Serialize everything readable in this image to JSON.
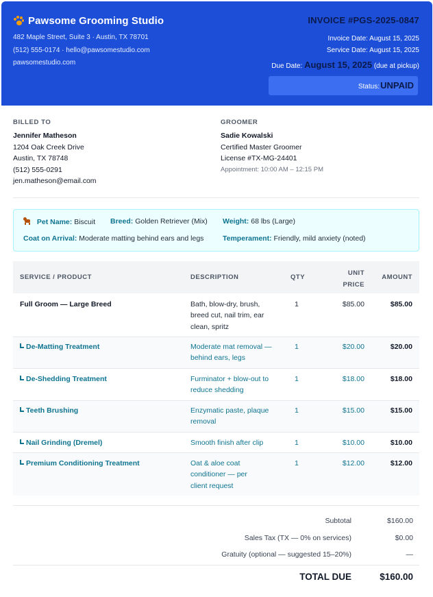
{
  "header": {
    "studio_name": "Pawsome Grooming Studio",
    "address": "482 Maple Street, Suite 3 · Austin, TX 78701",
    "contact": "(512) 555-0174 · hello@pawsomestudio.com",
    "website": "pawsomestudio.com",
    "invoice_number": "INVOICE #PGS-2025-0847",
    "invoice_date_label": "Invoice Date:",
    "invoice_date": "August 15, 2025",
    "service_date_label": "Service Date:",
    "service_date": "August 15, 2025",
    "due_date_label": "Due Date:",
    "due_date": "August 15, 2025",
    "due_note": "(due at pickup)",
    "status_label": "Status:",
    "status_value": "UNPAID",
    "colors": {
      "header_bg": "#1d4ed8",
      "accent": "#0e7490"
    }
  },
  "billed_to": {
    "title": "BILLED TO",
    "name": "Jennifer Matheson",
    "street": "1204 Oak Creek Drive",
    "city": "Austin, TX 78748",
    "phone": "(512) 555-0291",
    "email": "jen.matheson@email.com"
  },
  "groomer": {
    "title": "GROOMER",
    "name": "Sadie Kowalski",
    "role": "Certified Master Groomer",
    "license": "License #TX-MG-24401",
    "appointment": "Appointment: 10:00 AM – 12:15 PM"
  },
  "pet": {
    "name_label": "Pet Name:",
    "name": "Biscuit",
    "breed_label": "Breed:",
    "breed": "Golden Retriever (Mix)",
    "weight_label": "Weight:",
    "weight": "68 lbs (Large)",
    "coat_label": "Coat on Arrival:",
    "coat": "Moderate matting behind ears and legs",
    "temperament_label": "Temperament:",
    "temperament": "Friendly, mild anxiety (noted)"
  },
  "table": {
    "headers": {
      "service": "SERVICE / PRODUCT",
      "description": "DESCRIPTION",
      "qty": "QTY",
      "unit_line1": "UNIT",
      "unit_line2": "PRICE",
      "amount": "AMOUNT"
    },
    "rows": [
      {
        "service": "Full Groom — Large Breed",
        "description": "Bath, blow-dry, brush, breed cut, nail trim, ear clean, spritz",
        "qty": "1",
        "unit": "$85.00",
        "amount": "$85.00"
      },
      {
        "service": "De-Matting Treatment",
        "description": "Moderate mat removal — behind ears, legs",
        "qty": "1",
        "unit": "$20.00",
        "amount": "$20.00"
      },
      {
        "service": "De-Shedding Treatment",
        "description": "Furminator + blow-out to reduce shedding",
        "qty": "1",
        "unit": "$18.00",
        "amount": "$18.00"
      },
      {
        "service": "Teeth Brushing",
        "description": "Enzymatic paste, plaque removal",
        "qty": "1",
        "unit": "$15.00",
        "amount": "$15.00"
      },
      {
        "service": "Nail Grinding (Dremel)",
        "description": "Smooth finish after clip",
        "qty": "1",
        "unit": "$10.00",
        "amount": "$10.00"
      },
      {
        "service": "Premium Conditioning Treatment",
        "description": "Oat & aloe coat conditioner — per client request",
        "qty": "1",
        "unit": "$12.00",
        "amount": "$12.00"
      }
    ]
  },
  "totals": {
    "subtotal_label": "Subtotal",
    "subtotal": "$160.00",
    "tax_label": "Sales Tax (TX — 0% on services)",
    "tax": "$0.00",
    "gratuity_label": "Gratuity (optional — suggested 15–20%)",
    "gratuity": "—",
    "total_label": "TOTAL DUE",
    "total": "$160.00"
  }
}
